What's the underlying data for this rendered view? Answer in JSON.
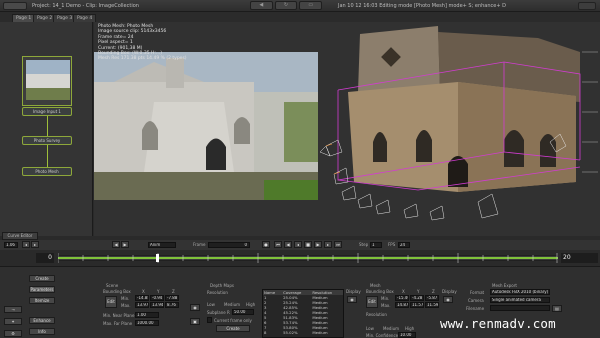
{
  "topbar": {
    "title": "Project: 14_1 Demo - Clip: ImageCollection",
    "window_title": "Jan 10 12 16:03 Editing mode [Photo Mesh] mode+ S; enhance+ D"
  },
  "tabs": [
    "Page 1",
    "Page 2",
    "Page 3",
    "Page 4"
  ],
  "nodes": {
    "image_input": "Image Input 1",
    "photo_survey": "Photo Survey",
    "photo_mesh": "Photo Mesh",
    "curve_editor": "Curve Editor"
  },
  "viewer": {
    "info": [
      "Photo Mesh: Photo Mesh",
      "Image source clip: 5143x3456",
      "Frame rate= 24",
      "Pixel aspect= 1",
      "Current: (901,38 M)",
      "Bounding Box: (W:0.35 H:...)",
      "Mesh Res 171.38 pts 14.49 % (2 types)"
    ]
  },
  "timebar": {
    "frame_label": "Frame",
    "frame_value": "0",
    "mode": "Anim",
    "step_label": "Step",
    "step_value": "1",
    "fps_label": "FPS",
    "fps_value": "24",
    "zoom": "1.06"
  },
  "timeline": {
    "start": "0",
    "end": "20"
  },
  "side_buttons": [
    "Create",
    "Parameters",
    "Itemize",
    "Enhance",
    "Info"
  ],
  "scene": {
    "title": "Scene",
    "bbox_label": "Bounding Box",
    "x": "X",
    "y": "Y",
    "z": "Z",
    "min_label": "Min.",
    "max_label": "Max.",
    "min": [
      "-14.88",
      "-0.94",
      "-7.88"
    ],
    "max": [
      "13.97",
      "13.94",
      "8.76"
    ],
    "edit": "Edit",
    "near_label": "Min. Near Plane",
    "near": "1.00",
    "far_label": "Max. Far Plane",
    "far": "1000.00"
  },
  "depth": {
    "title": "Depth Maps",
    "res_label": "Resolution",
    "low": "Low",
    "medium": "Medium",
    "high": "High",
    "subplane_label": "Subplane R",
    "subplane": "50.00",
    "current_only": "Current frame only",
    "create": "Create"
  },
  "table": {
    "headers": [
      "Name",
      "Coverage",
      "Resolution"
    ],
    "rows": [
      [
        "1",
        "25.04%",
        "Medium"
      ],
      [
        "2",
        "25.24%",
        "Medium"
      ],
      [
        "3",
        "42.85%",
        "Medium"
      ],
      [
        "4",
        "45.22%",
        "Medium"
      ],
      [
        "5",
        "51.83%",
        "Medium"
      ],
      [
        "6",
        "53.74%",
        "Medium"
      ],
      [
        "7",
        "53.80%",
        "Medium"
      ],
      [
        "8",
        "55.02%",
        "Medium"
      ]
    ],
    "display_label": "Display"
  },
  "mesh": {
    "title": "Mesh",
    "bbox_label": "Bounding Box",
    "x": "X",
    "y": "Y",
    "z": "Z",
    "min_label": "Min.",
    "max_label": "Max.",
    "min": [
      "-15.46",
      "-4.28",
      "-5.87"
    ],
    "max": [
      "14.87",
      "11.57",
      "11.59"
    ],
    "edit": "Edit",
    "res_label": "Resolution",
    "low": "Low",
    "medium": "Medium",
    "high": "High",
    "conf_label": "Min. Confidence %",
    "conf": "10.00",
    "display_label": "Display"
  },
  "export": {
    "title": "Mesh Export",
    "format_label": "Format",
    "format": "Autodesk FBX 2010 (binary)",
    "camera_label": "Camera",
    "camera": "Single animated camera",
    "filename_label": "Filename",
    "filename": "",
    "overwrite": "Overwrite",
    "export": "Export"
  },
  "watermark": "www.renmadv.com",
  "colors": {
    "accent": "#8ea83a",
    "timeline": "#7fc23a",
    "mesh_box": "#d23cd2"
  }
}
